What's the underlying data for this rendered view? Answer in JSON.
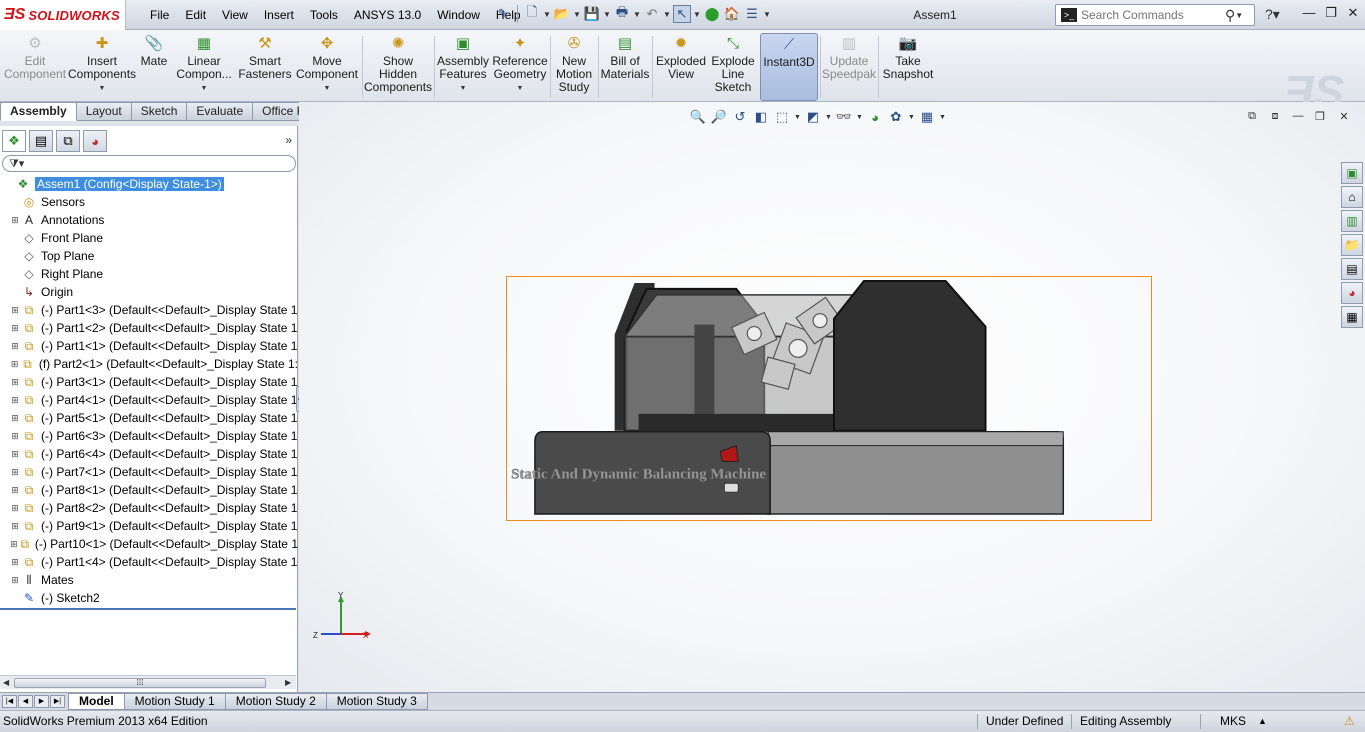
{
  "app": {
    "logo_text": "SOLIDWORKS",
    "document_title": "Assem1"
  },
  "menu": [
    "File",
    "Edit",
    "View",
    "Insert",
    "Tools",
    "ANSYS 13.0",
    "Window",
    "Help"
  ],
  "search": {
    "placeholder": "Search Commands"
  },
  "command_manager": {
    "commands": [
      {
        "id": "edit-component",
        "label": "Edit Component",
        "icon": "edit-component-icon",
        "disabled": true
      },
      {
        "id": "insert-components",
        "label": "Insert Components",
        "icon": "insert-components-icon",
        "dropdown": true
      },
      {
        "id": "mate",
        "label": "Mate",
        "icon": "mate-paperclip-icon"
      },
      {
        "id": "linear-component-pattern",
        "label": "Linear Compon...",
        "icon": "linear-pattern-icon",
        "dropdown": true
      },
      {
        "id": "smart-fasteners",
        "label": "Smart Fasteners",
        "icon": "smart-fasteners-icon"
      },
      {
        "id": "move-component",
        "label": "Move Component",
        "icon": "move-component-icon",
        "dropdown": true
      },
      {
        "id": "show-hidden-components",
        "label": "Show Hidden Components",
        "icon": "show-hidden-icon"
      },
      {
        "id": "assembly-features",
        "label": "Assembly Features",
        "icon": "assembly-features-icon",
        "dropdown": true
      },
      {
        "id": "reference-geometry",
        "label": "Reference Geometry",
        "icon": "reference-geometry-icon",
        "dropdown": true
      },
      {
        "id": "new-motion-study",
        "label": "New Motion Study",
        "icon": "motion-study-icon"
      },
      {
        "id": "bill-of-materials",
        "label": "Bill of Materials",
        "icon": "bom-icon"
      },
      {
        "id": "exploded-view",
        "label": "Exploded View",
        "icon": "exploded-view-icon"
      },
      {
        "id": "explode-line-sketch",
        "label": "Explode Line Sketch",
        "icon": "explode-line-icon"
      },
      {
        "id": "instant3d",
        "label": "Instant3D",
        "icon": "instant3d-icon",
        "active": true
      },
      {
        "id": "update-speedpak",
        "label": "Update Speedpak",
        "icon": "speedpak-icon",
        "disabled": true
      },
      {
        "id": "take-snapshot",
        "label": "Take Snapshot",
        "icon": "snapshot-icon"
      }
    ],
    "tabs": [
      {
        "label": "Assembly",
        "active": true
      },
      {
        "label": "Layout"
      },
      {
        "label": "Sketch"
      },
      {
        "label": "Evaluate"
      },
      {
        "label": "Office Products"
      }
    ]
  },
  "feature_tree": {
    "filter_icon": "filter-icon",
    "items": [
      {
        "label": "Assem1  (Config<Display State-1>)",
        "icon": "assembly-icon",
        "selected": true,
        "level": 0,
        "expandable": false
      },
      {
        "label": "Sensors",
        "icon": "sensor-icon",
        "level": 1
      },
      {
        "label": "Annotations",
        "icon": "annotations-icon",
        "level": 1,
        "expandable": true
      },
      {
        "label": "Front Plane",
        "icon": "plane-icon",
        "level": 1
      },
      {
        "label": "Top Plane",
        "icon": "plane-icon",
        "level": 1
      },
      {
        "label": "Right Plane",
        "icon": "plane-icon",
        "level": 1
      },
      {
        "label": "Origin",
        "icon": "origin-icon",
        "level": 1
      },
      {
        "label": "(-) Part1<3> (Default<<Default>_Display State 1",
        "icon": "part-icon",
        "level": 1,
        "expandable": true
      },
      {
        "label": "(-) Part1<2> (Default<<Default>_Display State 1",
        "icon": "part-icon",
        "level": 1,
        "expandable": true
      },
      {
        "label": "(-) Part1<1> (Default<<Default>_Display State 1",
        "icon": "part-icon",
        "level": 1,
        "expandable": true
      },
      {
        "label": "(f) Part2<1> (Default<<Default>_Display State 1:",
        "icon": "part-icon",
        "level": 1,
        "expandable": true
      },
      {
        "label": "(-) Part3<1> (Default<<Default>_Display State 1",
        "icon": "part-icon",
        "level": 1,
        "expandable": true
      },
      {
        "label": "(-) Part4<1> (Default<<Default>_Display State 1",
        "icon": "part-icon",
        "level": 1,
        "expandable": true
      },
      {
        "label": "(-) Part5<1> (Default<<Default>_Display State 1",
        "icon": "part-icon",
        "level": 1,
        "expandable": true
      },
      {
        "label": "(-) Part6<3> (Default<<Default>_Display State 1",
        "icon": "part-icon",
        "level": 1,
        "expandable": true
      },
      {
        "label": "(-) Part6<4> (Default<<Default>_Display State 1",
        "icon": "part-icon",
        "level": 1,
        "expandable": true
      },
      {
        "label": "(-) Part7<1> (Default<<Default>_Display State 1",
        "icon": "part-icon",
        "level": 1,
        "expandable": true
      },
      {
        "label": "(-) Part8<1> (Default<<Default>_Display State 1",
        "icon": "part-icon",
        "level": 1,
        "expandable": true
      },
      {
        "label": "(-) Part8<2> (Default<<Default>_Display State 1",
        "icon": "part-icon",
        "level": 1,
        "expandable": true
      },
      {
        "label": "(-) Part9<1> (Default<<Default>_Display State 1",
        "icon": "part-icon",
        "level": 1,
        "expandable": true
      },
      {
        "label": "(-) Part10<1> (Default<<Default>_Display State 1",
        "icon": "part-icon",
        "level": 1,
        "expandable": true
      },
      {
        "label": "(-) Part1<4> (Default<<Default>_Display State 1",
        "icon": "part-icon",
        "level": 1,
        "expandable": true
      },
      {
        "label": "Mates",
        "icon": "mates-icon",
        "level": 1,
        "expandable": true
      },
      {
        "label": "(-) Sketch2",
        "icon": "sketch-icon",
        "level": 1
      }
    ]
  },
  "graphics": {
    "model_label": "Static And Dynamic Balancing Machine",
    "triad": {
      "x": "X",
      "y": "Y",
      "z": "Z"
    }
  },
  "motion_tabs": [
    {
      "label": "Model",
      "active": true
    },
    {
      "label": "Motion Study 1"
    },
    {
      "label": "Motion Study 2"
    },
    {
      "label": "Motion Study 3"
    }
  ],
  "status": {
    "edition": "SolidWorks Premium 2013 x64 Edition",
    "definition": "Under Defined",
    "mode": "Editing Assembly",
    "units": "MKS"
  },
  "colors": {
    "brand_red": "#d1111a",
    "selection_blue": "#3d8ee0",
    "selection_box": "#f08a24"
  }
}
